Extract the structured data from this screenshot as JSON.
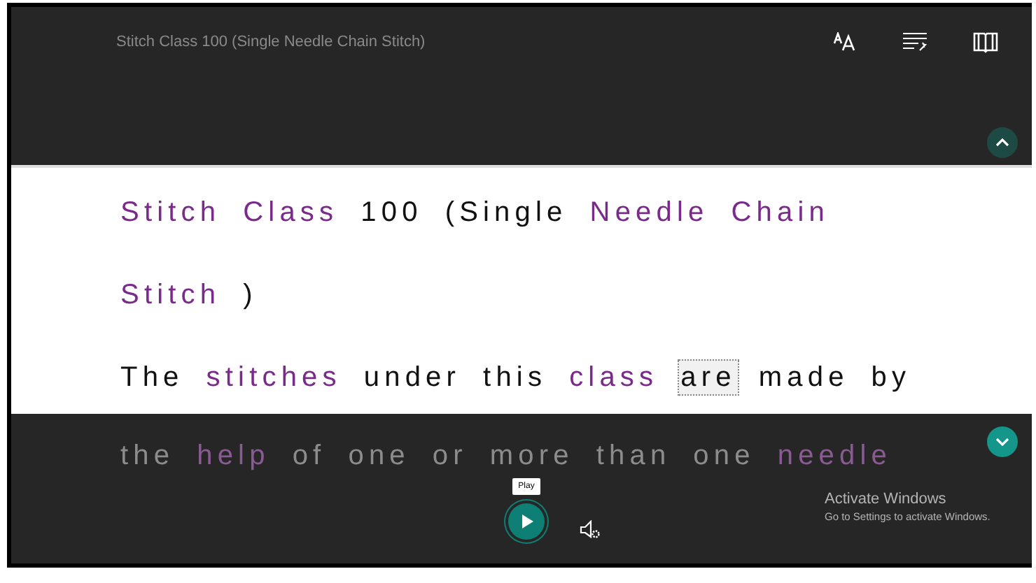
{
  "header": {
    "title": "Stitch Class 100 (Single Needle Chain Stitch)"
  },
  "lines": [
    {
      "in_focus": true,
      "words": [
        {
          "text": "Stitch",
          "highlighted": true,
          "selected": false
        },
        {
          "text": "Class",
          "highlighted": true,
          "selected": false
        },
        {
          "text": "100",
          "highlighted": false,
          "selected": false
        },
        {
          "text": "(Single",
          "highlighted": false,
          "selected": false
        },
        {
          "text": "Needle",
          "highlighted": true,
          "selected": false
        },
        {
          "text": "Chain",
          "highlighted": true,
          "selected": false
        }
      ]
    },
    {
      "in_focus": true,
      "words": [
        {
          "text": "Stitch",
          "highlighted": true,
          "selected": false
        },
        {
          "text": ")",
          "highlighted": false,
          "selected": false
        }
      ]
    },
    {
      "in_focus": true,
      "words": [
        {
          "text": "The",
          "highlighted": false,
          "selected": false
        },
        {
          "text": "stitches",
          "highlighted": true,
          "selected": false
        },
        {
          "text": "under",
          "highlighted": false,
          "selected": false
        },
        {
          "text": "this",
          "highlighted": false,
          "selected": false
        },
        {
          "text": "class",
          "highlighted": true,
          "selected": false
        },
        {
          "text": "are",
          "highlighted": false,
          "selected": true
        },
        {
          "text": "made",
          "highlighted": false,
          "selected": false
        },
        {
          "text": "by",
          "highlighted": false,
          "selected": false
        }
      ]
    },
    {
      "in_focus": false,
      "words": [
        {
          "text": "the",
          "highlighted": false,
          "selected": false
        },
        {
          "text": "help",
          "highlighted": true,
          "selected": false
        },
        {
          "text": "of",
          "highlighted": false,
          "selected": false
        },
        {
          "text": "one",
          "highlighted": false,
          "selected": false
        },
        {
          "text": "or",
          "highlighted": false,
          "selected": false
        },
        {
          "text": "more",
          "highlighted": false,
          "selected": false
        },
        {
          "text": "than",
          "highlighted": false,
          "selected": false
        },
        {
          "text": "one",
          "highlighted": false,
          "selected": false
        },
        {
          "text": "needle",
          "highlighted": true,
          "selected": false
        }
      ]
    }
  ],
  "player": {
    "tooltip": "Play"
  },
  "os_notice": {
    "title": "Activate Windows",
    "message": "Go to Settings to activate Windows."
  }
}
